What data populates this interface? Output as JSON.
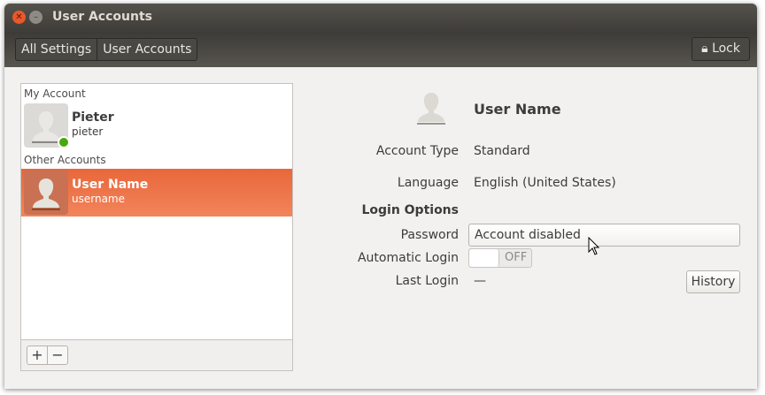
{
  "window": {
    "title": "User Accounts"
  },
  "toolbar": {
    "breadcrumbs": [
      "All Settings",
      "User Accounts"
    ],
    "lock_label": "Lock"
  },
  "accounts": {
    "my_account_header": "My Account",
    "other_accounts_header": "Other Accounts",
    "me": {
      "name": "Pieter",
      "username": "pieter"
    },
    "others": [
      {
        "name": "User Name",
        "username": "username"
      }
    ],
    "add_label": "+",
    "remove_label": "−"
  },
  "details": {
    "name": "User Name",
    "account_type_label": "Account Type",
    "account_type": "Standard",
    "language_label": "Language",
    "language": "English (United States)",
    "login_options_label": "Login Options",
    "password_label": "Password",
    "password": "Account disabled",
    "auto_login_label": "Automatic Login",
    "auto_login_state": "OFF",
    "last_login_label": "Last Login",
    "last_login": "—",
    "history_label": "History"
  }
}
